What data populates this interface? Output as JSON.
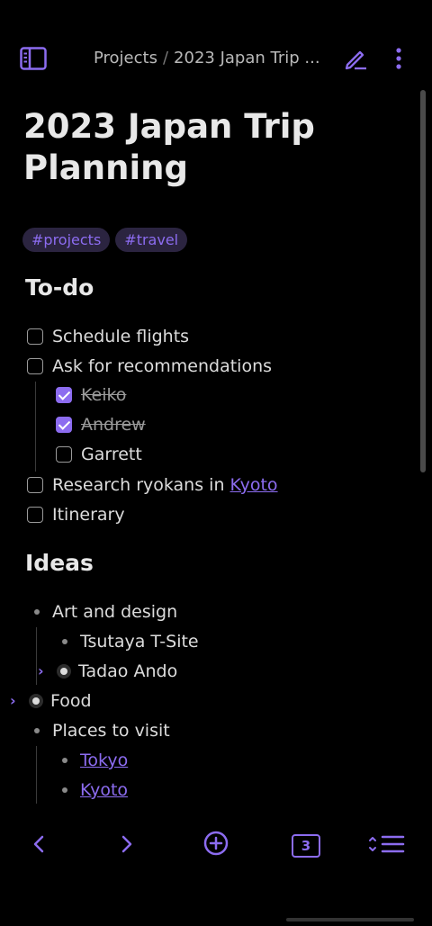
{
  "header": {
    "breadcrumb_parent": "Projects",
    "breadcrumb_sep": "/",
    "breadcrumb_current": "2023 Japan Trip ..."
  },
  "note": {
    "title": "2023 Japan Trip Planning",
    "tags": [
      "#projects",
      "#travel"
    ]
  },
  "todo_section": {
    "heading": "To-do",
    "items": [
      {
        "label": "Schedule flights",
        "checked": false
      },
      {
        "label": "Ask for recommendations",
        "checked": false
      },
      {
        "label": "Keiko",
        "checked": true
      },
      {
        "label": "Andrew",
        "checked": true
      },
      {
        "label": "Garrett",
        "checked": false
      },
      {
        "label": "Research ryokans in ",
        "link": "Kyoto",
        "checked": false
      },
      {
        "label": "Itinerary",
        "checked": false
      }
    ]
  },
  "ideas_section": {
    "heading": "Ideas",
    "items": [
      {
        "label": "Art and design"
      },
      {
        "label": "Tsutaya T-Site"
      },
      {
        "label": "Tadao Ando",
        "collapsed": true
      },
      {
        "label": "Food",
        "collapsed": true
      },
      {
        "label": "Places to visit"
      },
      {
        "link": "Tokyo"
      },
      {
        "link": "Kyoto"
      }
    ]
  },
  "bottom_bar": {
    "tab_count": "3"
  },
  "colors": {
    "accent": "#8c6cf0",
    "background": "#000000",
    "tag_bg": "#2b2440"
  }
}
